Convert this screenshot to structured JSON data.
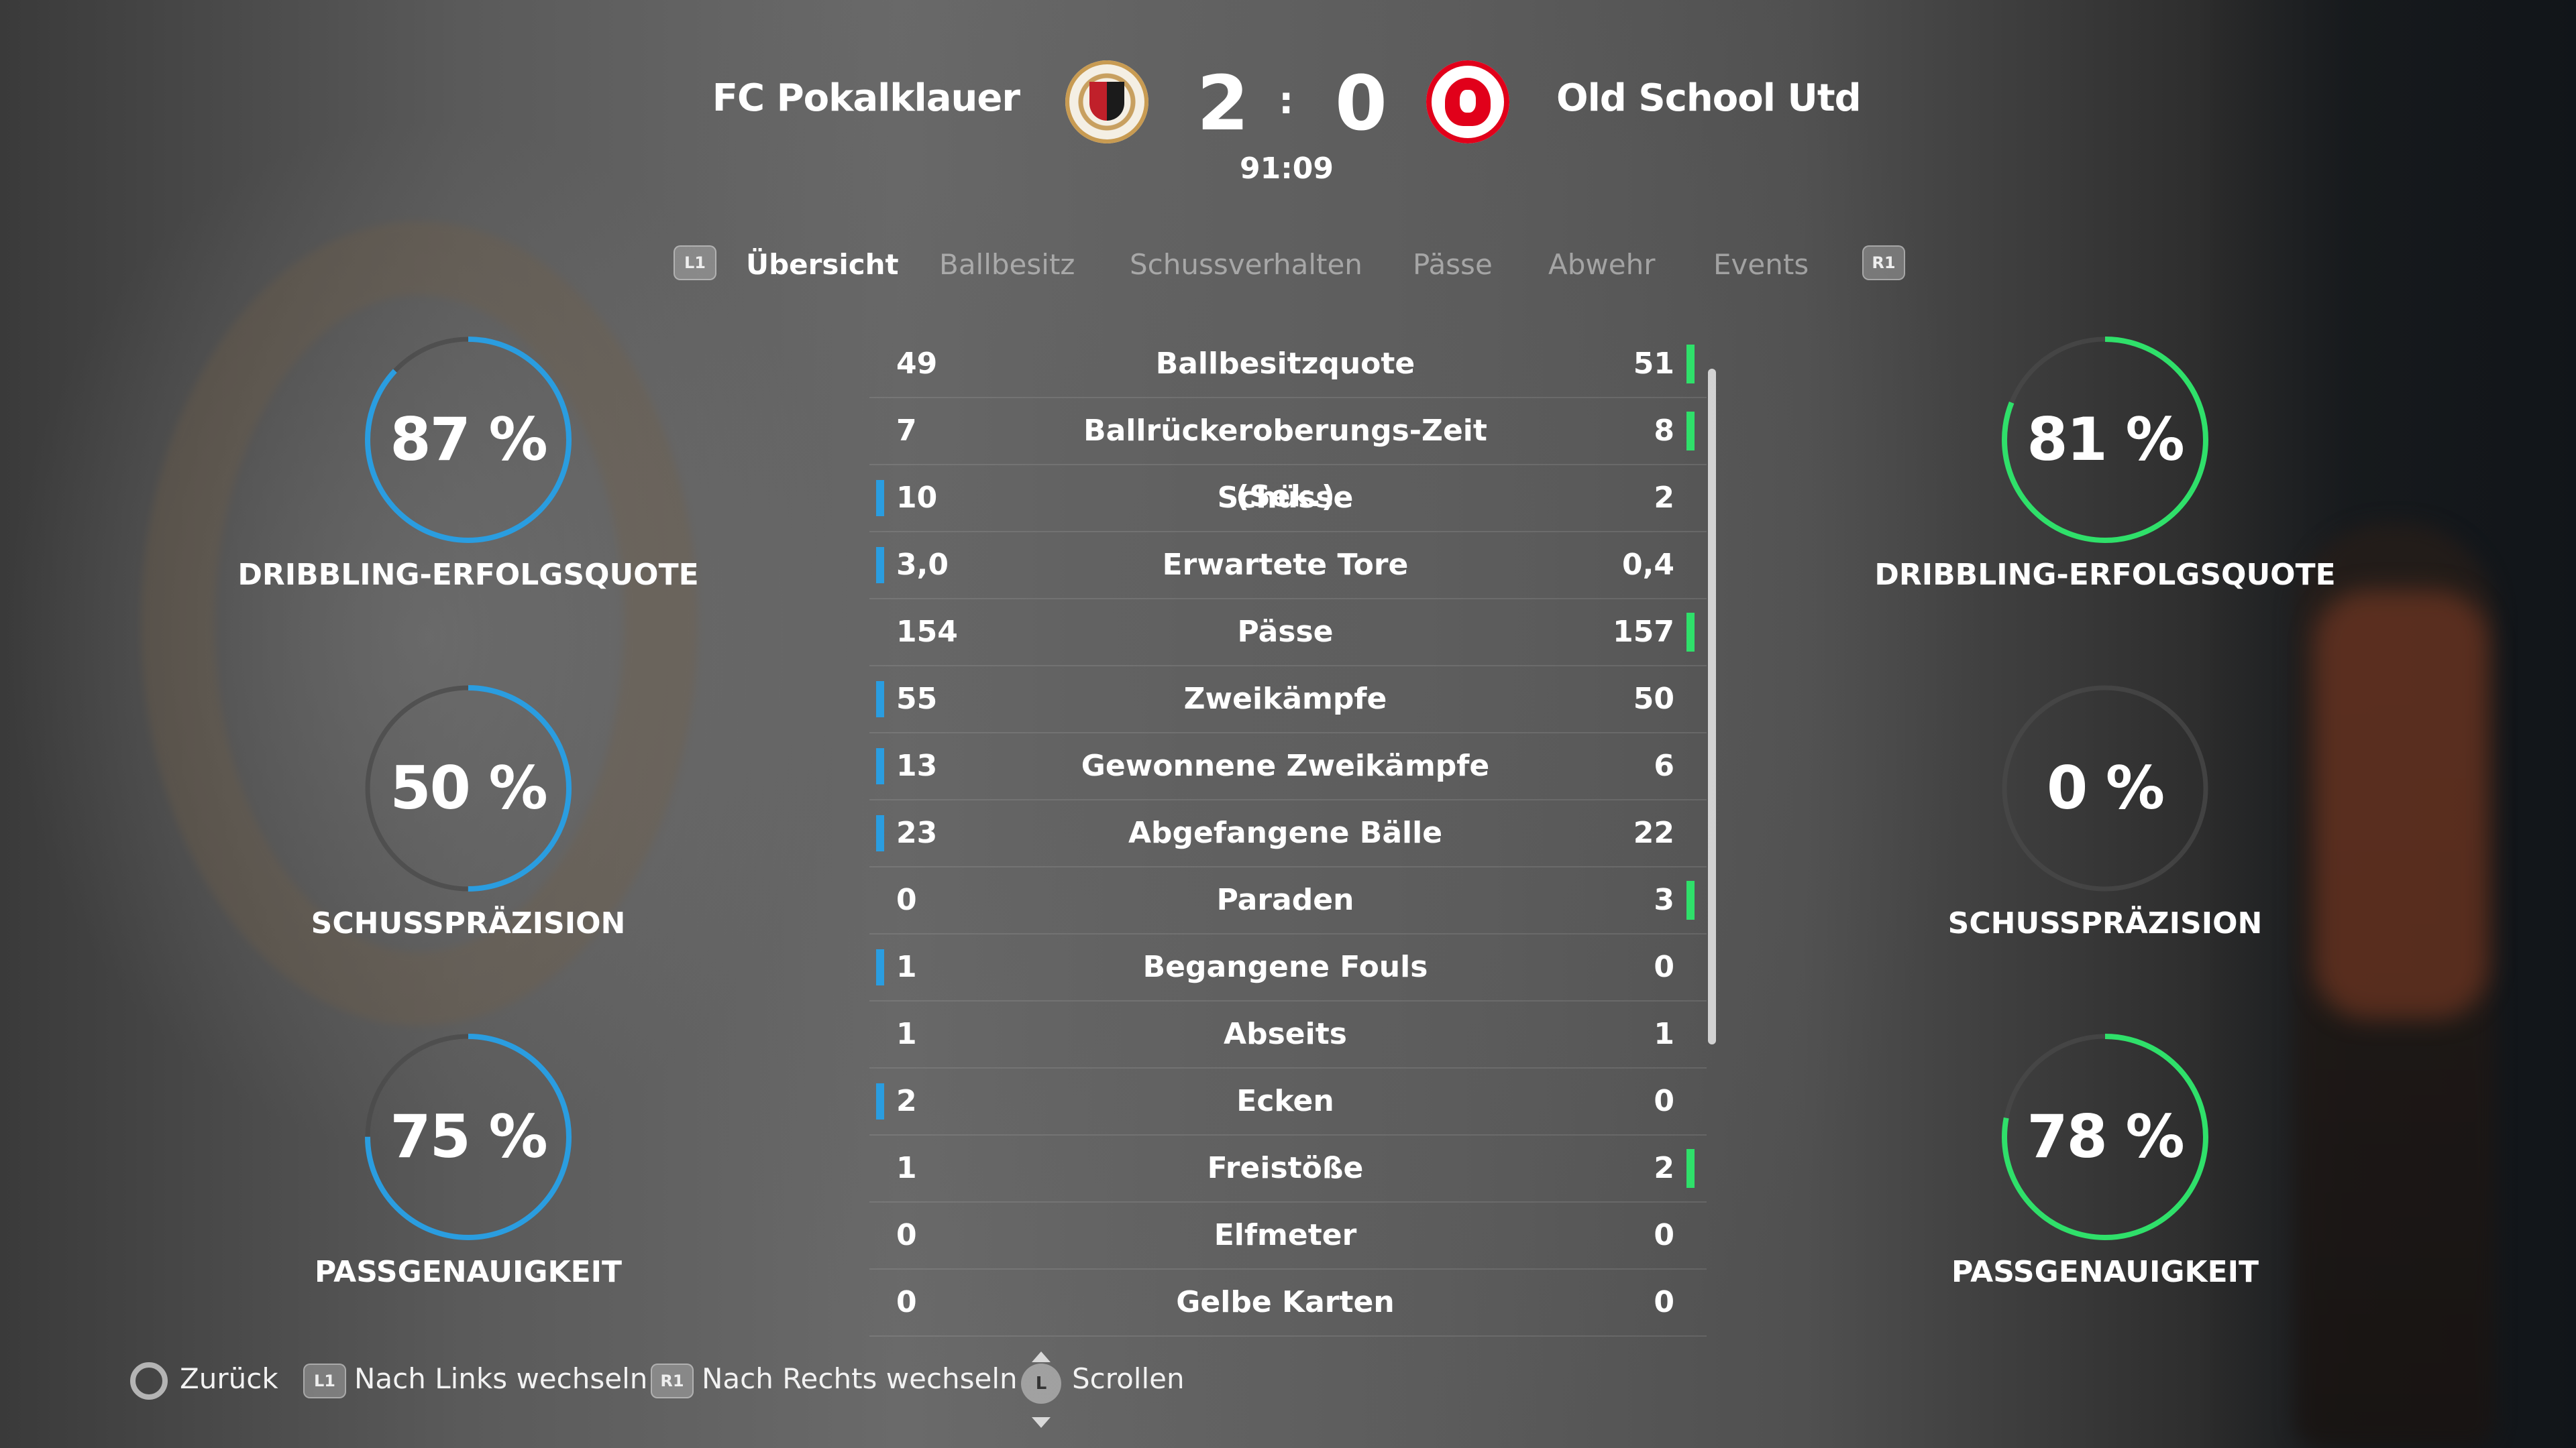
{
  "header": {
    "home_team": "FC Pokalklauer",
    "away_team": "Old School Utd",
    "home_score": "2",
    "separator": ":",
    "away_score": "0",
    "clock": "91:09",
    "home_crest_icon": "bromley-crest-icon",
    "away_crest_icon": "eagle-crest-icon"
  },
  "tabs": {
    "left_button": "L1",
    "right_button": "R1",
    "items": [
      "Übersicht",
      "Ballbesitz",
      "Schussverhalten",
      "Pässe",
      "Abwehr",
      "Events"
    ],
    "active_index": 0
  },
  "home_rings": [
    {
      "value": "87 %",
      "label": "DRIBBLING-ERFOLGSQUOTE",
      "fraction": 0.87
    },
    {
      "value": "50 %",
      "label": "SCHUSSPRÄZISION",
      "fraction": 0.5
    },
    {
      "value": "75 %",
      "label": "PASSGENAUIGKEIT",
      "fraction": 0.75
    }
  ],
  "away_rings": [
    {
      "value": "81 %",
      "label": "DRIBBLING-ERFOLGSQUOTE",
      "fraction": 0.81
    },
    {
      "value": "0 %",
      "label": "SCHUSSPRÄZISION",
      "fraction": 0.0
    },
    {
      "value": "78 %",
      "label": "PASSGENAUIGKEIT",
      "fraction": 0.78
    }
  ],
  "stats": [
    {
      "home": "49",
      "label": "Ballbesitzquote",
      "away": "51",
      "leader": "away"
    },
    {
      "home": "7",
      "label": "Ballrückeroberungs-Zeit (Sek.)",
      "away": "8",
      "leader": "away"
    },
    {
      "home": "10",
      "label": "Schüsse",
      "away": "2",
      "leader": "home"
    },
    {
      "home": "3,0",
      "label": "Erwartete Tore",
      "away": "0,4",
      "leader": "home"
    },
    {
      "home": "154",
      "label": "Pässe",
      "away": "157",
      "leader": "away"
    },
    {
      "home": "55",
      "label": "Zweikämpfe",
      "away": "50",
      "leader": "home"
    },
    {
      "home": "13",
      "label": "Gewonnene Zweikämpfe",
      "away": "6",
      "leader": "home"
    },
    {
      "home": "23",
      "label": "Abgefangene Bälle",
      "away": "22",
      "leader": "home"
    },
    {
      "home": "0",
      "label": "Paraden",
      "away": "3",
      "leader": "away"
    },
    {
      "home": "1",
      "label": "Begangene Fouls",
      "away": "0",
      "leader": "home"
    },
    {
      "home": "1",
      "label": "Abseits",
      "away": "1",
      "leader": "none"
    },
    {
      "home": "2",
      "label": "Ecken",
      "away": "0",
      "leader": "home"
    },
    {
      "home": "1",
      "label": "Freistöße",
      "away": "2",
      "leader": "away"
    },
    {
      "home": "0",
      "label": "Elfmeter",
      "away": "0",
      "leader": "none"
    },
    {
      "home": "0",
      "label": "Gelbe Karten",
      "away": "0",
      "leader": "none"
    }
  ],
  "colors": {
    "home_accent": "#2a9de0",
    "away_accent": "#2fe06a",
    "ring_track": "#4a4a4a"
  },
  "footer": {
    "back_label": "Zurück",
    "left_switch_button": "L1",
    "left_switch_label": "Nach Links wechseln",
    "right_switch_button": "R1",
    "right_switch_label": "Nach Rechts wechseln",
    "scroll_button": "L",
    "scroll_label": "Scrollen"
  }
}
